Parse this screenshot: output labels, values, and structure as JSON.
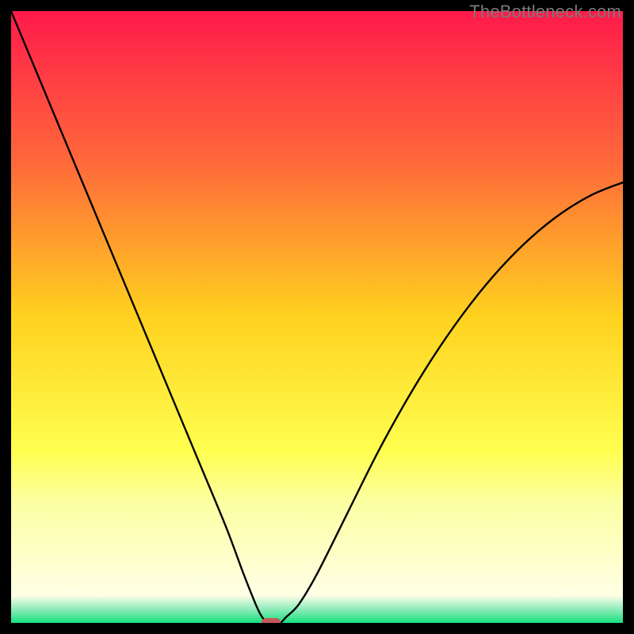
{
  "watermark": "TheBottleneck.com",
  "chart_data": {
    "type": "line",
    "title": "",
    "xlabel": "",
    "ylabel": "",
    "xlim": [
      0,
      100
    ],
    "ylim": [
      0,
      100
    ],
    "grid": false,
    "legend": false,
    "background_gradient": {
      "stops": [
        {
          "pos": 0.0,
          "color": "#ff1a4b"
        },
        {
          "pos": 0.25,
          "color": "#ff6a3a"
        },
        {
          "pos": 0.5,
          "color": "#ffd21f"
        },
        {
          "pos": 0.72,
          "color": "#ffff50"
        },
        {
          "pos": 0.8,
          "color": "#fcffa0"
        },
        {
          "pos": 0.955,
          "color": "#ffffe6"
        },
        {
          "pos": 0.975,
          "color": "#9beec0"
        },
        {
          "pos": 1.0,
          "color": "#17e07e"
        }
      ]
    },
    "series": [
      {
        "name": "bottleneck-curve",
        "color": "#000000",
        "x": [
          0,
          5,
          10,
          15,
          20,
          25,
          30,
          35,
          38,
          40,
          41,
          42,
          43,
          44,
          45,
          47,
          50,
          55,
          60,
          65,
          70,
          75,
          80,
          85,
          90,
          95,
          100
        ],
        "y": [
          100,
          88,
          76,
          64,
          52,
          40,
          28,
          16,
          8,
          3,
          1,
          0,
          0,
          0,
          1,
          3,
          8,
          18,
          28,
          37,
          45,
          52,
          58,
          63,
          67,
          70,
          72
        ]
      }
    ],
    "marker": {
      "name": "optimal-point",
      "x": 42.5,
      "y": 0,
      "color": "#c25a5a",
      "width_pct": 3.2,
      "height_pct": 1.6
    }
  }
}
